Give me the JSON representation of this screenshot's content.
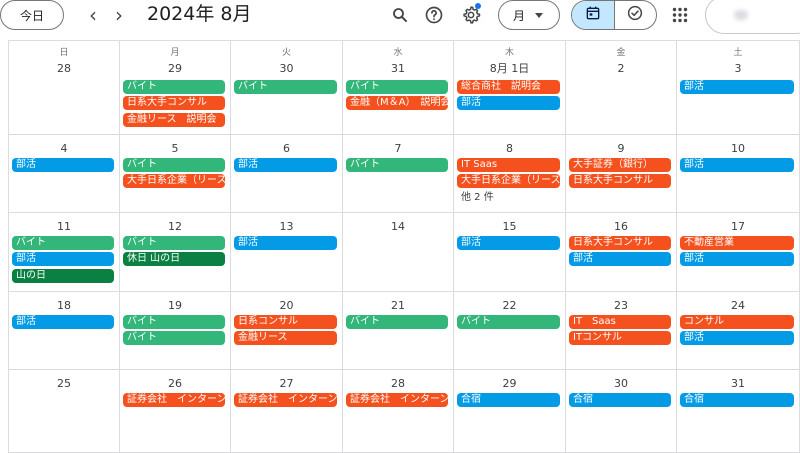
{
  "header": {
    "today_label": "今日",
    "prev_glyph": "‹",
    "next_glyph": "›",
    "month_title": "2024年 8月",
    "icons": [
      "search-icon",
      "help-icon",
      "settings-icon",
      "apps-icon"
    ],
    "view_label": "月",
    "view_toggle": [
      "calendar-icon",
      "tasks-icon"
    ],
    "accent_color": "#1a73e8",
    "active_toggle_color": "#c2e7ff"
  },
  "calendar": {
    "weekdays": [
      "日",
      "月",
      "火",
      "水",
      "木",
      "金",
      "土"
    ],
    "event_colors": {
      "green": "#33b679",
      "orange": "#f4511e",
      "blue": "#039be5",
      "darkgreen": "#0b8043"
    },
    "weeks": [
      [
        {
          "day": "28",
          "events": []
        },
        {
          "day": "29",
          "events": [
            {
              "t": "バイト",
              "c": "green"
            },
            {
              "t": "日系大手コンサル",
              "c": "orange"
            },
            {
              "t": "金融リース　説明会",
              "c": "orange"
            }
          ]
        },
        {
          "day": "30",
          "events": [
            {
              "t": "バイト",
              "c": "green"
            }
          ]
        },
        {
          "day": "31",
          "events": [
            {
              "t": "バイト",
              "c": "green"
            },
            {
              "t": "金融（M＆A）　説明会",
              "c": "orange"
            }
          ]
        },
        {
          "day": "8月 1日",
          "events": [
            {
              "t": "総合商社　説明会",
              "c": "orange"
            },
            {
              "t": "部活",
              "c": "blue"
            }
          ]
        },
        {
          "day": "2",
          "events": []
        },
        {
          "day": "3",
          "events": [
            {
              "t": "部活",
              "c": "blue"
            }
          ]
        }
      ],
      [
        {
          "day": "4",
          "events": [
            {
              "t": "部活",
              "c": "blue"
            }
          ]
        },
        {
          "day": "5",
          "events": [
            {
              "t": "バイト",
              "c": "green"
            },
            {
              "t": "大手日系企業（リース）",
              "c": "orange"
            }
          ]
        },
        {
          "day": "6",
          "events": [
            {
              "t": "部活",
              "c": "blue"
            }
          ]
        },
        {
          "day": "7",
          "events": [
            {
              "t": "バイト",
              "c": "green"
            }
          ]
        },
        {
          "day": "8",
          "events": [
            {
              "t": "IT Saas",
              "c": "orange"
            },
            {
              "t": "大手日系企業（リース）",
              "c": "orange"
            }
          ],
          "more": "他 2 件"
        },
        {
          "day": "9",
          "events": [
            {
              "t": "大手証券（銀行）",
              "c": "orange"
            },
            {
              "t": "日系大手コンサル",
              "c": "orange"
            }
          ]
        },
        {
          "day": "10",
          "events": [
            {
              "t": "部活",
              "c": "blue"
            }
          ]
        }
      ],
      [
        {
          "day": "11",
          "events": [
            {
              "t": "バイト",
              "c": "green"
            },
            {
              "t": "部活",
              "c": "blue"
            },
            {
              "t": "山の日",
              "c": "darkgreen"
            }
          ]
        },
        {
          "day": "12",
          "events": [
            {
              "t": "バイト",
              "c": "green"
            },
            {
              "t": "休日 山の日",
              "c": "darkgreen"
            }
          ]
        },
        {
          "day": "13",
          "events": [
            {
              "t": "部活",
              "c": "blue"
            }
          ]
        },
        {
          "day": "14",
          "events": []
        },
        {
          "day": "15",
          "events": [
            {
              "t": "部活",
              "c": "blue"
            }
          ]
        },
        {
          "day": "16",
          "events": [
            {
              "t": "日系大手コンサル",
              "c": "orange"
            },
            {
              "t": "部活",
              "c": "blue"
            }
          ]
        },
        {
          "day": "17",
          "events": [
            {
              "t": "不動産営業",
              "c": "orange"
            },
            {
              "t": "部活",
              "c": "blue"
            }
          ]
        }
      ],
      [
        {
          "day": "18",
          "events": [
            {
              "t": "部活",
              "c": "blue"
            }
          ]
        },
        {
          "day": "19",
          "events": [
            {
              "t": "バイト",
              "c": "green"
            },
            {
              "t": "バイト",
              "c": "green"
            }
          ]
        },
        {
          "day": "20",
          "events": [
            {
              "t": "日系コンサル",
              "c": "orange"
            },
            {
              "t": "金融リース",
              "c": "orange"
            }
          ]
        },
        {
          "day": "21",
          "events": [
            {
              "t": "バイト",
              "c": "green"
            }
          ]
        },
        {
          "day": "22",
          "events": [
            {
              "t": "バイト",
              "c": "green"
            }
          ]
        },
        {
          "day": "23",
          "events": [
            {
              "t": "IT　Saas",
              "c": "orange"
            },
            {
              "t": "ITコンサル",
              "c": "orange"
            }
          ]
        },
        {
          "day": "24",
          "events": [
            {
              "t": "コンサル",
              "c": "orange"
            },
            {
              "t": "部活",
              "c": "blue"
            }
          ]
        }
      ],
      [
        {
          "day": "25",
          "events": []
        },
        {
          "day": "26",
          "events": [
            {
              "t": "証券会社　インターン",
              "c": "orange"
            }
          ]
        },
        {
          "day": "27",
          "events": [
            {
              "t": "証券会社　インターン",
              "c": "orange"
            }
          ]
        },
        {
          "day": "28",
          "events": [
            {
              "t": "証券会社　インターン",
              "c": "orange"
            }
          ]
        },
        {
          "day": "29",
          "events": [
            {
              "t": "合宿",
              "c": "blue"
            }
          ]
        },
        {
          "day": "30",
          "events": [
            {
              "t": "合宿",
              "c": "blue"
            }
          ]
        },
        {
          "day": "31",
          "events": [
            {
              "t": "合宿",
              "c": "blue"
            }
          ]
        }
      ]
    ]
  }
}
